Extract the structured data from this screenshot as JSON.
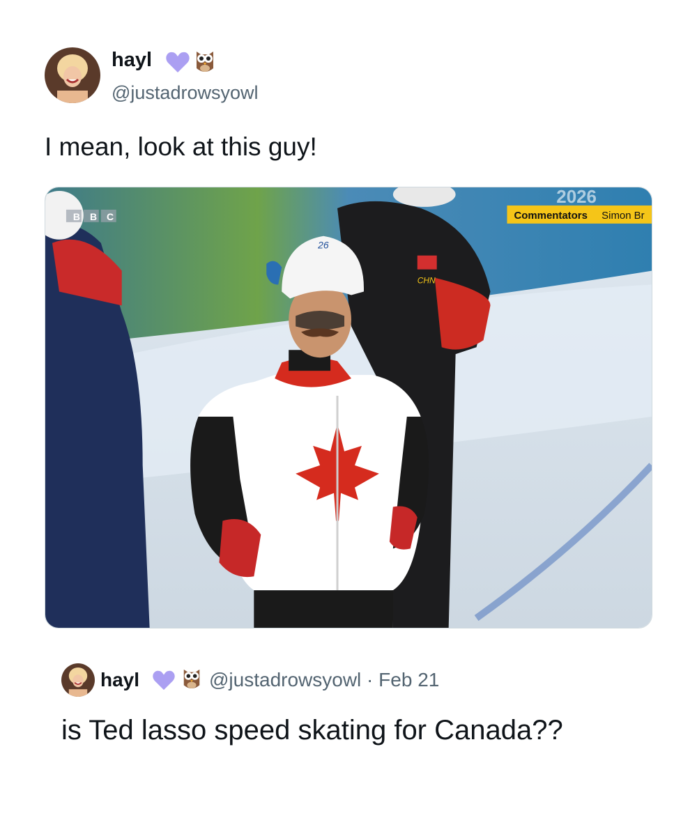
{
  "tweet": {
    "author_name": "hayl",
    "author_handle": "@justadrowsyowl",
    "text": "I mean, look at this guy!",
    "emojis": [
      "purple-heart",
      "owl"
    ]
  },
  "media": {
    "broadcaster_logo": "BBC",
    "caption_label": "Commentators",
    "caption_text": "Simon Br",
    "country_code": "CHN",
    "year_text": "2026",
    "helmet_text": "26"
  },
  "quoted_tweet": {
    "author_name": "hayl",
    "author_handle": "@justadrowsyowl",
    "separator": " · ",
    "date": "Feb 21",
    "text": "is Ted lasso speed skating for Canada??"
  },
  "colors": {
    "text": "#0f1419",
    "secondary": "#536471",
    "heart": "#ab9ff2",
    "canada_red": "#d52b1e",
    "caption_yellow": "#f5c518"
  }
}
